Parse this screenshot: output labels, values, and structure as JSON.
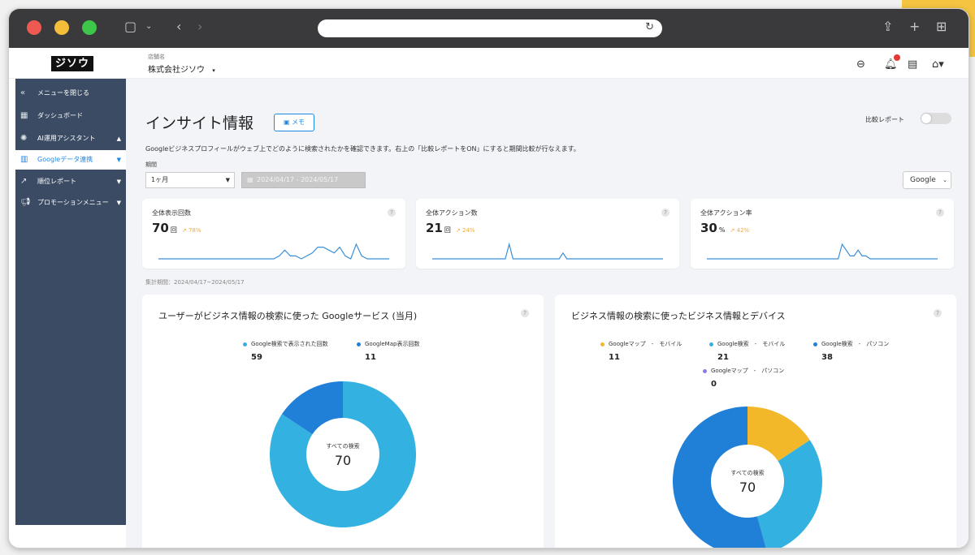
{
  "header": {
    "logo_text": "ジソウ",
    "shop_label": "店舗名",
    "shop_name": "株式会社ジソウ"
  },
  "sidebar": {
    "items": [
      {
        "label": "メニューを閉じる",
        "icon": "double-chevron-left-icon"
      },
      {
        "label": "ダッシュボード",
        "icon": "dashboard-icon"
      },
      {
        "label": "AI運用アシスタント",
        "icon": "ai-assistant-icon"
      },
      {
        "label": "Googleデータ連携",
        "icon": "bar-chart-icon",
        "active": true
      },
      {
        "label": "順位レポート",
        "icon": "trend-line-icon"
      },
      {
        "label": "プロモーションメニュー",
        "icon": "megaphone-icon"
      }
    ]
  },
  "page": {
    "title": "インサイト情報",
    "memo_label": "メモ",
    "compare_label": "比較レポート",
    "description": "Googleビジネスプロフィールがウェブ上でどのように検索されたかを確認できます。右上の「比較レポートをON」にすると期間比較が行なえます。",
    "period_label": "期間",
    "period_value": "1ヶ月",
    "date_range": "2024/04/17 - 2024/05/17",
    "source_value": "Google",
    "aggregation_period": "集計期間：2024/04/17~2024/05/17"
  },
  "kpis": [
    {
      "title": "全体表示回数",
      "value": "70",
      "unit": "回",
      "trend": "↗ 78%",
      "spark": [
        1,
        1,
        1,
        1,
        1,
        1,
        1,
        1,
        1,
        1,
        1,
        1,
        1,
        1,
        1,
        1,
        1,
        1,
        1,
        1,
        1,
        1,
        2,
        4,
        2,
        2,
        1,
        2,
        3,
        5,
        5,
        4,
        3,
        5,
        2,
        1,
        6,
        2,
        1,
        1,
        1,
        1,
        1
      ]
    },
    {
      "title": "全体アクション数",
      "value": "21",
      "unit": "回",
      "trend": "↗ 24%",
      "spark": [
        1,
        1,
        1,
        1,
        1,
        1,
        1,
        1,
        1,
        1,
        1,
        1,
        1,
        1,
        1,
        1,
        1,
        1,
        1,
        1,
        6,
        1,
        1,
        1,
        1,
        1,
        1,
        1,
        1,
        1,
        1,
        1,
        1,
        1,
        3,
        1,
        1,
        1,
        1,
        1,
        1,
        1,
        1,
        1,
        1,
        1,
        1,
        1,
        1,
        1,
        1,
        1,
        1,
        1,
        1,
        1,
        1,
        1,
        1,
        1,
        1
      ]
    },
    {
      "title": "全体アクション率",
      "value": "30",
      "unit": "%",
      "trend": "↗ 42%",
      "spark": [
        1,
        1,
        1,
        1,
        1,
        1,
        1,
        1,
        1,
        1,
        1,
        1,
        1,
        1,
        1,
        1,
        1,
        1,
        1,
        1,
        1,
        1,
        1,
        1,
        1,
        1,
        1,
        1,
        1,
        1,
        1,
        1,
        1,
        1,
        6,
        4,
        2,
        2,
        4,
        2,
        2,
        1,
        1,
        1,
        1,
        1,
        1,
        1,
        1,
        1,
        1,
        1,
        1,
        1,
        1,
        1,
        1,
        1,
        1
      ]
    }
  ],
  "chart_data": [
    {
      "type": "pie",
      "title": "ユーザーがビジネス情報の検索に使った Googleサービス (当月)",
      "center_label": "すべての検索",
      "center_value": "70",
      "series": [
        {
          "name": "Google検索で表示された回数",
          "value": 59,
          "color": "#33b2e1"
        },
        {
          "name": "GoogleMap表示回数",
          "value": 11,
          "color": "#2080d8"
        }
      ]
    },
    {
      "type": "pie",
      "title": "ビジネス情報の検索に使ったビジネス情報とデバイス",
      "center_label": "すべての検索",
      "center_value": "70",
      "series": [
        {
          "name": "Googleマップ　-　モバイル",
          "value": 11,
          "color": "#f3b82a"
        },
        {
          "name": "Google検索　-　モバイル",
          "value": 21,
          "color": "#33b2e1"
        },
        {
          "name": "Google検索　-　パソコン",
          "value": 38,
          "color": "#2080d8"
        },
        {
          "name": "Googleマップ　-　パソコン",
          "value": 0,
          "color": "#8c7ae6"
        }
      ]
    }
  ]
}
